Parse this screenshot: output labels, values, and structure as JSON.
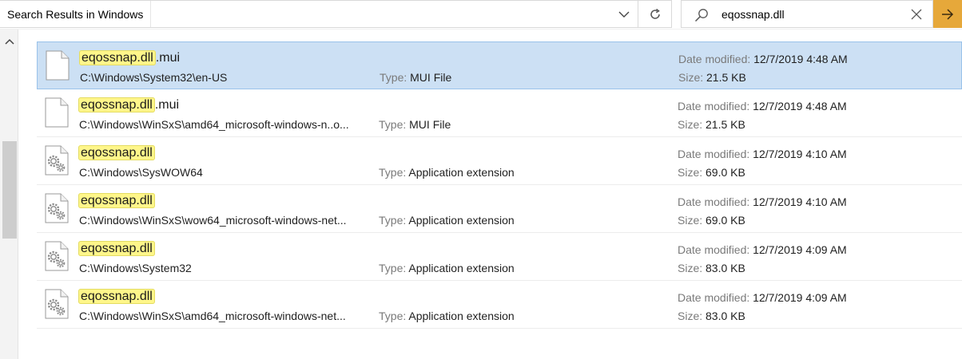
{
  "address_bar": {
    "location": "Search Results in Windows"
  },
  "search": {
    "query": "eqossnap.dll"
  },
  "labels": {
    "type": "Type:",
    "date_modified": "Date modified:",
    "size": "Size:"
  },
  "results": [
    {
      "match": "eqossnap.dll",
      "suffix": ".mui",
      "path": "C:\\Windows\\System32\\en-US",
      "type": "MUI File",
      "date": "12/7/2019 4:48 AM",
      "size": "21.5 KB",
      "icon": "document-icon",
      "selected": true
    },
    {
      "match": "eqossnap.dll",
      "suffix": ".mui",
      "path": "C:\\Windows\\WinSxS\\amd64_microsoft-windows-n..o...",
      "type": "MUI File",
      "date": "12/7/2019 4:48 AM",
      "size": "21.5 KB",
      "icon": "document-icon",
      "selected": false
    },
    {
      "match": "eqossnap.dll",
      "suffix": "",
      "path": "C:\\Windows\\SysWOW64",
      "type": "Application extension",
      "date": "12/7/2019 4:10 AM",
      "size": "69.0 KB",
      "icon": "dll-gear-icon",
      "selected": false
    },
    {
      "match": "eqossnap.dll",
      "suffix": "",
      "path": "C:\\Windows\\WinSxS\\wow64_microsoft-windows-net...",
      "type": "Application extension",
      "date": "12/7/2019 4:10 AM",
      "size": "69.0 KB",
      "icon": "dll-gear-icon",
      "selected": false
    },
    {
      "match": "eqossnap.dll",
      "suffix": "",
      "path": "C:\\Windows\\System32",
      "type": "Application extension",
      "date": "12/7/2019 4:09 AM",
      "size": "83.0 KB",
      "icon": "dll-gear-icon",
      "selected": false
    },
    {
      "match": "eqossnap.dll",
      "suffix": "",
      "path": "C:\\Windows\\WinSxS\\amd64_microsoft-windows-net...",
      "type": "Application extension",
      "date": "12/7/2019 4:09 AM",
      "size": "83.0 KB",
      "icon": "dll-gear-icon",
      "selected": false
    }
  ],
  "colors": {
    "selection": "#cce0f4",
    "highlight": "#fff68a",
    "search_go": "#e6a83a"
  }
}
